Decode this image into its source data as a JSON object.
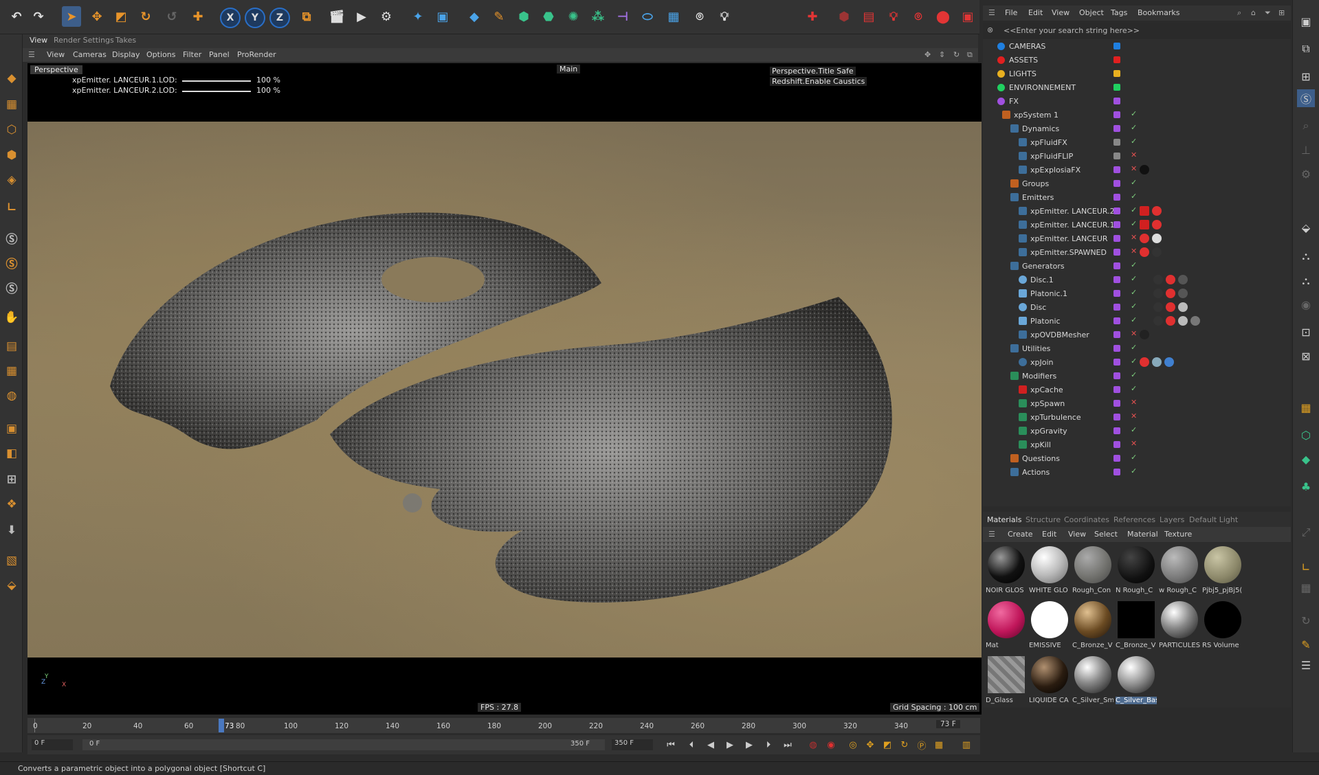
{
  "view_tabs": [
    "View",
    "Render Settings",
    "Takes"
  ],
  "view_menu": [
    "View",
    "Cameras",
    "Display",
    "Options",
    "Filter",
    "Panel",
    "ProRender"
  ],
  "viewport": {
    "camera_label": "Perspective",
    "main_label": "Main",
    "lod_rows": [
      {
        "label": "xpEmitter. LANCEUR.1.LOD:",
        "value": "100 %"
      },
      {
        "label": "xpEmitter. LANCEUR.2.LOD:",
        "value": "100 %"
      }
    ],
    "overlay_right": [
      "Perspective.Title Safe",
      "Redshift.Enable Caustics"
    ],
    "fps": "FPS : 27.8",
    "grid_spacing": "Grid Spacing : 100 cm",
    "axis_y": "Y",
    "axis_z": "Z",
    "axis_x": "X"
  },
  "object_manager": {
    "menus": [
      "File",
      "Edit",
      "View",
      "Object",
      "Tags",
      "Bookmarks"
    ],
    "search_placeholder": "<<Enter your search string here>>",
    "rows": [
      {
        "name": "CAMERAS",
        "color": "#1f7fe0"
      },
      {
        "name": "ASSETS",
        "color": "#e02020"
      },
      {
        "name": "LIGHTS",
        "color": "#e8b020"
      },
      {
        "name": "ENVIRONNEMENT",
        "color": "#20d060"
      },
      {
        "name": "FX",
        "color": "#a050e0"
      },
      {
        "name": "xpSystem 1"
      },
      {
        "name": "Dynamics"
      },
      {
        "name": "xpFluidFX"
      },
      {
        "name": "xpFluidFLIP"
      },
      {
        "name": "xpExplosiaFX"
      },
      {
        "name": "Groups"
      },
      {
        "name": "Emitters"
      },
      {
        "name": "xpEmitter. LANCEUR.2"
      },
      {
        "name": "xpEmitter. LANCEUR.1"
      },
      {
        "name": "xpEmitter. LANCEUR"
      },
      {
        "name": "xpEmitter.SPAWNED"
      },
      {
        "name": "Generators"
      },
      {
        "name": "Disc.1"
      },
      {
        "name": "Platonic.1"
      },
      {
        "name": "Disc"
      },
      {
        "name": "Platonic"
      },
      {
        "name": "xpOVDBMesher"
      },
      {
        "name": "Utilities"
      },
      {
        "name": "xpJoin"
      },
      {
        "name": "Modifiers"
      },
      {
        "name": "xpCache"
      },
      {
        "name": "xpSpawn"
      },
      {
        "name": "xpTurbulence"
      },
      {
        "name": "xpGravity"
      },
      {
        "name": "xpKill"
      },
      {
        "name": "Questions"
      },
      {
        "name": "Actions"
      }
    ]
  },
  "materials": {
    "tabs": [
      "Materials",
      "Structure",
      "Coordinates",
      "References",
      "Layers",
      "Default Light"
    ],
    "menu": [
      "Create",
      "Edit",
      "View",
      "Select",
      "Material",
      "Texture"
    ],
    "items": [
      {
        "label": "NOIR GLOS"
      },
      {
        "label": "WHITE GLO"
      },
      {
        "label": "Rough_Con"
      },
      {
        "label": "N Rough_C"
      },
      {
        "label": "w Rough_C"
      },
      {
        "label": "Pjbj5_pjBj5("
      },
      {
        "label": "Mat"
      },
      {
        "label": "EMISSIVE"
      },
      {
        "label": "C_Bronze_V"
      },
      {
        "label": "C_Bronze_V"
      },
      {
        "label": "PARTICULES"
      },
      {
        "label": "RS Volume"
      },
      {
        "label": "D_Glass"
      },
      {
        "label": "LIQUIDE CA"
      },
      {
        "label": "C_Silver_Sm"
      },
      {
        "label": "C_Silver_Bas"
      }
    ]
  },
  "timeline": {
    "ticks": [
      "0",
      "20",
      "40",
      "60",
      "80",
      "100",
      "120",
      "140",
      "160",
      "180",
      "200",
      "220",
      "240",
      "260",
      "280",
      "300",
      "320",
      "340"
    ],
    "current_marker": "73",
    "current_field": "73 F",
    "start_field": "0 F",
    "range_start": "0 F",
    "range_end": "350 F",
    "end_field": "350 F"
  },
  "status": "Converts a parametric object into a polygonal object [Shortcut C]"
}
